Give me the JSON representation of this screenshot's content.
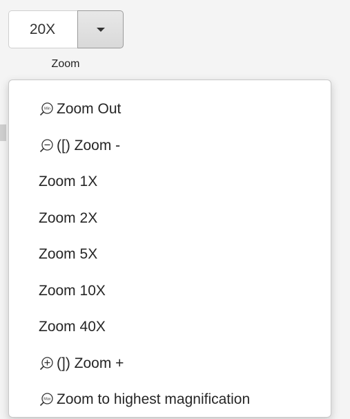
{
  "zoom_control": {
    "value": "20X",
    "caption": "Zoom"
  },
  "menu": {
    "items": [
      {
        "label": "Zoom Out",
        "icon": "zoom-min-icon"
      },
      {
        "label": "([) Zoom -",
        "icon": "zoom-minus-icon"
      },
      {
        "label": "Zoom 1X",
        "icon": ""
      },
      {
        "label": "Zoom 2X",
        "icon": ""
      },
      {
        "label": "Zoom 5X",
        "icon": ""
      },
      {
        "label": "Zoom 10X",
        "icon": ""
      },
      {
        "label": "Zoom 40X",
        "icon": ""
      },
      {
        "label": "(]) Zoom +",
        "icon": "zoom-plus-icon"
      },
      {
        "label": "Zoom to highest magnification",
        "icon": "zoom-max-icon"
      }
    ],
    "icon_badges": {
      "min": "Min",
      "max": "Max"
    }
  }
}
